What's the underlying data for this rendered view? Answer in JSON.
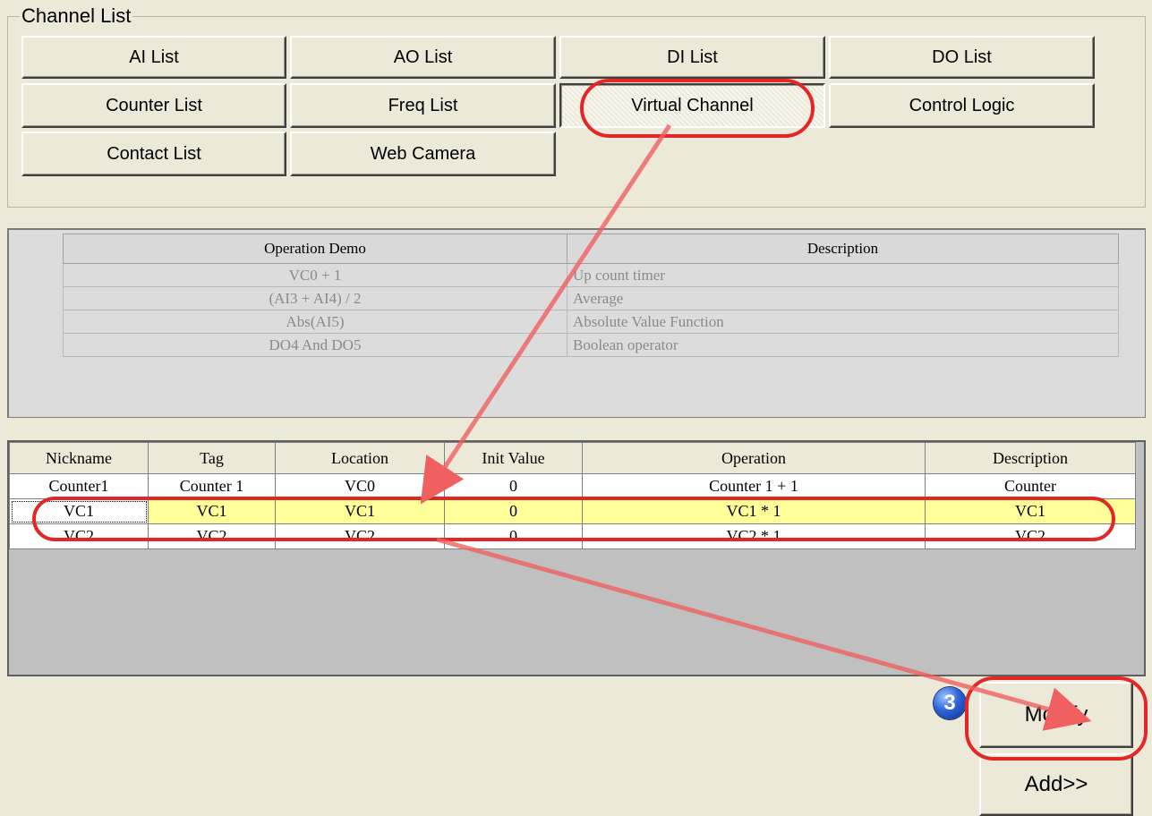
{
  "channel_list": {
    "title": "Channel List",
    "buttons": [
      {
        "label": "AI List"
      },
      {
        "label": "AO List"
      },
      {
        "label": "DI List"
      },
      {
        "label": "DO List"
      },
      {
        "label": "Counter List"
      },
      {
        "label": "Freq List"
      },
      {
        "label": "Virtual Channel",
        "selected": true
      },
      {
        "label": "Control Logic"
      },
      {
        "label": "Contact List"
      },
      {
        "label": "Web Camera"
      }
    ]
  },
  "operation_demo": {
    "headers": [
      "Operation Demo",
      "Description"
    ],
    "rows": [
      {
        "operation": "VC0 + 1",
        "description": "Up count timer"
      },
      {
        "operation": "(AI3 + AI4) / 2",
        "description": "Average"
      },
      {
        "operation": "Abs(AI5)",
        "description": "Absolute Value Function"
      },
      {
        "operation": "DO4 And DO5",
        "description": "Boolean operator"
      }
    ]
  },
  "channels": {
    "headers": [
      "Nickname",
      "Tag",
      "Location",
      "Init Value",
      "Operation",
      "Description"
    ],
    "rows": [
      {
        "nickname": "Counter1",
        "tag": "Counter  1",
        "location": "VC0",
        "init": "0",
        "operation": "Counter  1 + 1",
        "description": "Counter"
      },
      {
        "nickname": "VC1",
        "tag": "VC1",
        "location": "VC1",
        "init": "0",
        "operation": "VC1 * 1",
        "description": "VC1",
        "selected": true
      },
      {
        "nickname": "VC2",
        "tag": "VC2",
        "location": "VC2",
        "init": "0",
        "operation": "VC2 * 1",
        "description": "VC2"
      }
    ]
  },
  "actions": {
    "modify_label": "Modify",
    "add_label": "Add>>",
    "step_badge": "3"
  },
  "colors": {
    "highlight": "#e52626",
    "selected_row": "#ffff99",
    "badge": "#2e63d6"
  }
}
